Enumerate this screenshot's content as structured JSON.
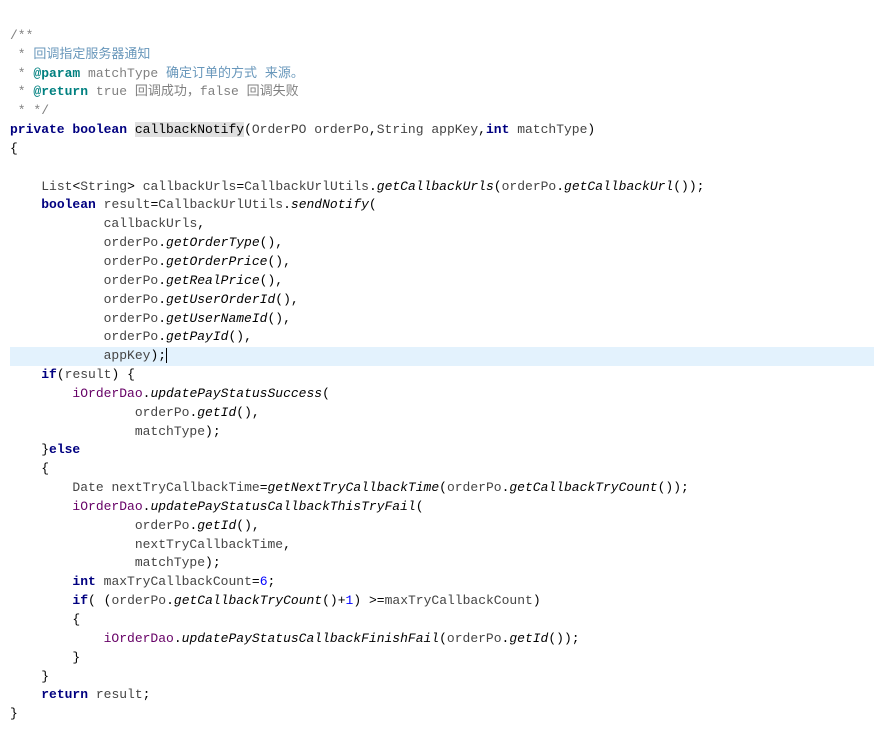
{
  "code": {
    "comment1": "/**",
    "comment2": " * ",
    "comment2text": "回调指定服务器通知",
    "comment3": " * ",
    "comment3tag": "@param",
    "comment3var": " matchType ",
    "comment3text": "确定订单的方式 来源。",
    "comment4": " * ",
    "comment4tag": "@return",
    "comment4text": " true 回调成功，false 回调失败",
    "comment5": " * */",
    "kw_private": "private",
    "kw_boolean": "boolean",
    "method_name": "callbackNotify",
    "type_orderpo": "OrderPO",
    "param_orderpo": "orderPo",
    "type_string": "String",
    "param_appkey": "appKey",
    "kw_int": "int",
    "param_matchtype": "matchType",
    "brace_open": "{",
    "type_list": "List",
    "type_string2": "String",
    "var_callbackurls": "callbackUrls",
    "class_cbuutils": "CallbackUrlUtils",
    "method_getcburls": "getCallbackUrls",
    "var_orderpo": "orderPo",
    "method_getcburl": "getCallbackUrl",
    "var_result": "result",
    "method_sendnotify": "sendNotify",
    "var_cburls2": "callbackUrls",
    "method_getordertype": "getOrderType",
    "method_getorderprice": "getOrderPrice",
    "method_getrealprice": "getRealPrice",
    "method_getuserorderid": "getUserOrderId",
    "method_getusernameid": "getUserNameId",
    "method_getpayid": "getPayId",
    "var_appkey2": "appKey",
    "kw_if": "if",
    "var_result2": "result",
    "field_iorderdao": "iOrderDao",
    "method_updatepss": "updatePayStatusSuccess",
    "method_getid": "getId",
    "var_matchtype2": "matchType",
    "kw_else": "else",
    "type_date": "Date",
    "var_nexttry": "nextTryCallbackTime",
    "method_getnexttry": "getNextTryCallbackTime",
    "method_getcbtrycount": "getCallbackTryCount",
    "method_updatepscbtf": "updatePayStatusCallbackThisTryFail",
    "var_nexttry2": "nextTryCallbackTime",
    "var_maxtry": "maxTryCallbackCount",
    "num_6": "6",
    "num_1": "1",
    "method_updatepscbff": "updatePayStatusCallbackFinishFail",
    "kw_return": "return",
    "var_result3": "result",
    "brace_close": "}"
  }
}
